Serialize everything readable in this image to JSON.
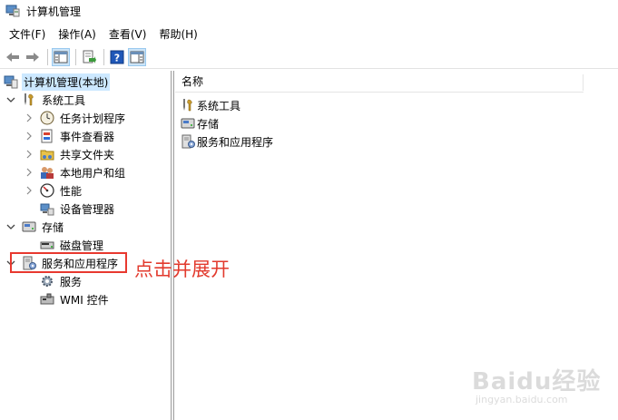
{
  "window": {
    "title": "计算机管理"
  },
  "menu": [
    "文件(F)",
    "操作(A)",
    "查看(V)",
    "帮助(H)"
  ],
  "toolbar": [
    "back-arrow-icon",
    "forward-arrow-icon",
    "show-hide-tree-icon",
    "export-list-icon",
    "help-icon",
    "show-hide-action-pane-icon"
  ],
  "tree": {
    "root": "计算机管理(本地)",
    "system_tools": "系统工具",
    "task_scheduler": "任务计划程序",
    "event_viewer": "事件查看器",
    "shared_folders": "共享文件夹",
    "local_users": "本地用户和组",
    "performance": "性能",
    "device_manager": "设备管理器",
    "storage": "存储",
    "disk_management": "磁盘管理",
    "services_apps": "服务和应用程序",
    "services": "服务",
    "wmi": "WMI 控件"
  },
  "list": {
    "column_header": "名称",
    "items": [
      "系统工具",
      "存储",
      "服务和应用程序"
    ]
  },
  "annotation": "点击并展开",
  "watermark": {
    "main": "Baidu经验",
    "sub": "jingyan.baidu.com"
  },
  "colors": {
    "highlight": "#e8392f",
    "selection": "#cce8ff"
  }
}
